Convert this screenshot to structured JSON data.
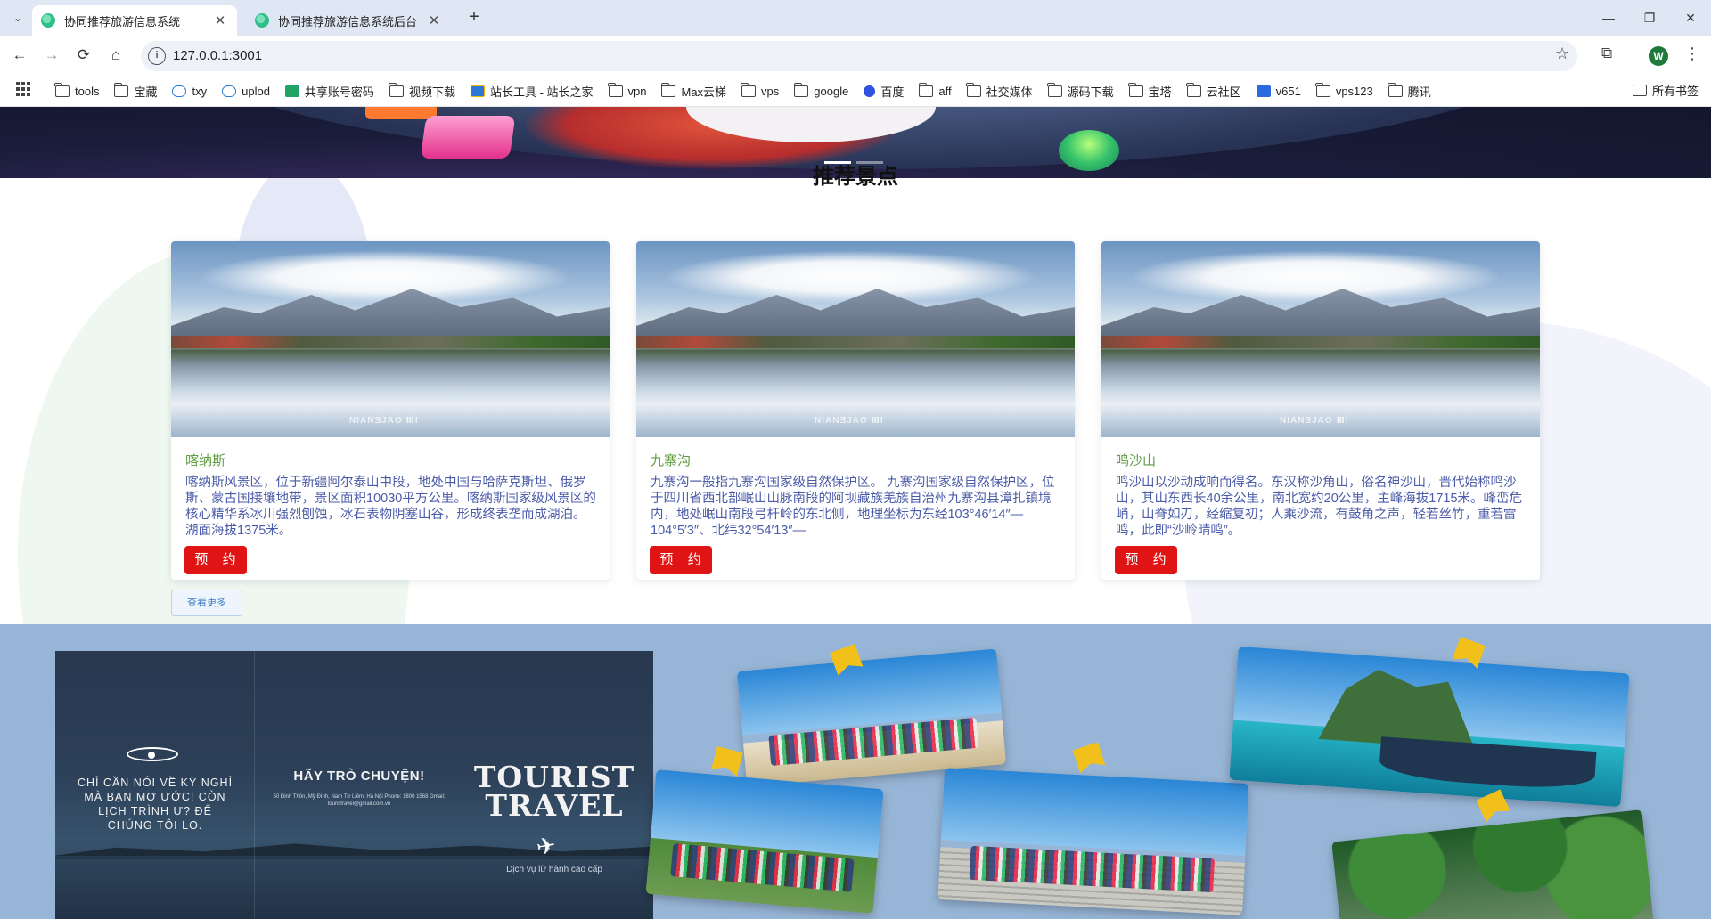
{
  "browser": {
    "tabs": [
      {
        "title": "协同推荐旅游信息系统",
        "active": true
      },
      {
        "title": "协同推荐旅游信息系统后台",
        "active": false
      }
    ],
    "url": "127.0.0.1:3001",
    "profile_initial": "W",
    "icons": {
      "back": "←",
      "forward": "→",
      "reload": "⟳",
      "home": "⌂",
      "info": "i",
      "star": "☆",
      "extensions": "⧉",
      "menu": "⋮",
      "tab_menu": "⌄",
      "close": "✕",
      "new_tab": "+",
      "minimize": "—",
      "restore": "❐",
      "window_close": "✕"
    },
    "bookmarks": [
      {
        "label": "tools",
        "icon": "folder"
      },
      {
        "label": "宝藏",
        "icon": "folder"
      },
      {
        "label": "txy",
        "icon": "cloud"
      },
      {
        "label": "uplod",
        "icon": "cloud"
      },
      {
        "label": "共享账号密码",
        "icon": "green"
      },
      {
        "label": "视频下载",
        "icon": "folder"
      },
      {
        "label": "站长工具 - 站长之家",
        "icon": "tool"
      },
      {
        "label": "vpn",
        "icon": "folder"
      },
      {
        "label": "Max云梯",
        "icon": "folder"
      },
      {
        "label": "vps",
        "icon": "folder"
      },
      {
        "label": "google",
        "icon": "folder"
      },
      {
        "label": "百度",
        "icon": "paw"
      },
      {
        "label": "aff",
        "icon": "folder"
      },
      {
        "label": "社交媒体",
        "icon": "folder"
      },
      {
        "label": "源码下载",
        "icon": "folder"
      },
      {
        "label": "宝塔",
        "icon": "folder"
      },
      {
        "label": "云社区",
        "icon": "folder"
      },
      {
        "label": "v651",
        "icon": "blue"
      },
      {
        "label": "vps123",
        "icon": "folder"
      },
      {
        "label": "腾讯",
        "icon": "folder"
      }
    ],
    "all_bookmarks": "所有书签"
  },
  "page": {
    "section_title": "推荐景点",
    "book_label": "预 约",
    "more_label": "查看更多",
    "photo_watermark": "NIANƎJAO ⅢI",
    "attractions": [
      {
        "name": "喀纳斯",
        "desc": "喀纳斯风景区，位于新疆阿尔泰山中段，地处中国与哈萨克斯坦、俄罗斯、蒙古国接壤地带，景区面积10030平方公里。喀纳斯国家级风景区的核心精华系冰川强烈刨蚀，冰石表物阴塞山谷，形成终表垄而成湖泊。湖面海拔1375米。"
      },
      {
        "name": "九寨沟",
        "desc": "九寨沟一般指九寨沟国家级自然保护区。 九寨沟国家级自然保护区，位于四川省西北部岷山山脉南段的阿坝藏族羌族自治州九寨沟县漳扎镇境内，地处岷山南段弓杆岭的东北侧，地理坐标为东经103°46′14″—104°5′3″、北纬32°54′13″—"
      },
      {
        "name": "鸣沙山",
        "desc": "鸣沙山以沙动成响而得名。东汉称沙角山，俗名神沙山，晋代始称鸣沙山，其山东西长40余公里，南北宽约20公里，主峰海拔1715米。峰峦危峭，山脊如刃，经缩复初；人乘沙流，有鼓角之声，轻若丝竹，重若雷鸣，此即“沙岭晴鸣”。"
      }
    ],
    "flyer": {
      "text1": "CHỈ CẦN NÓI VỀ KỲ NGHỈ MÀ BẠN MƠ ƯỚC! CÒN LỊCH TRÌNH Ư? ĐỂ CHÚNG TÔI LO.",
      "text2": "HÃY TRÒ CHUYỆN!",
      "text3": "50 Đinh Thôn, Mỹ Đình, Nam Từ Liêm, Hà Nội Phone: 1800 1568 Gmail: touristravel@gmail.com.vn",
      "text4": "TOURIST TRAVEL",
      "text5": "Dịch vụ lữ hành cao cấp",
      "plane": "✈"
    }
  }
}
